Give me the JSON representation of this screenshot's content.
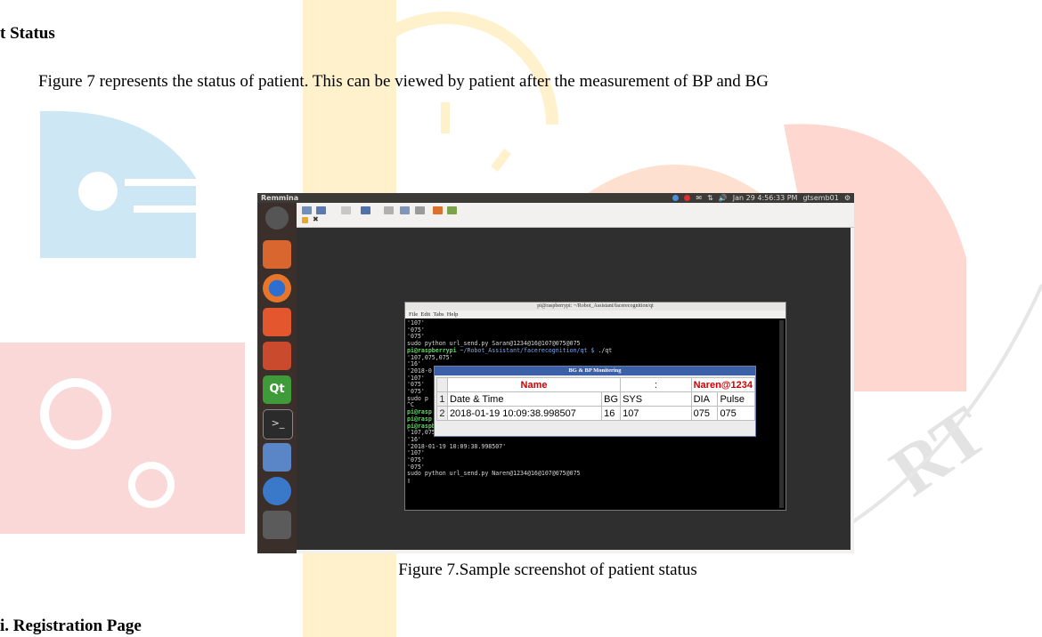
{
  "document": {
    "heading": "t Status",
    "paragraph": "Figure 7 represents the status of patient. This can be viewed by patient after the measurement of BP and BG",
    "caption": "Figure 7.Sample screenshot of patient status",
    "next_heading": "i. Registration Page"
  },
  "desktop": {
    "app_name": "Remmina",
    "clock": "Jan 29  4:56:33 PM",
    "user": "gtsemb01",
    "launcher_icons": [
      "dash-icon",
      "files-icon",
      "firefox-icon",
      "software-center-icon",
      "settings-icon",
      "qt-icon",
      "terminal-icon",
      "remote-desktop-icon",
      "app-icon",
      "workspace-icon",
      "trash-icon"
    ]
  },
  "terminal": {
    "title": "pi@raspberrypi: ~/Robot_Assistant/facerecognition/qt",
    "menu": [
      "File",
      "Edit",
      "Tabs",
      "Help"
    ],
    "lines_top": [
      "'107'",
      "'075'",
      "'075'",
      "sudo python url_send.py Saran@1234@16@107@075@075"
    ],
    "prompt_user": "pi@raspberrypi",
    "prompt_path": " ~/Robot_Assistant/facerecognition/qt $ ",
    "prompt_cmd": "./qt",
    "lines_mid": [
      "'107,075,075'",
      "'16'",
      "'2018-0",
      "'107'",
      "'075'",
      "'075'",
      "sudo p",
      "^C",
      "pi@rasp",
      "pi@rasp"
    ],
    "lines_bottom": [
      "'107,075,075'",
      "'16'",
      "'2018-01-19 10:09:38.998507'",
      "'107'",
      "'075'",
      "'075'",
      "sudo python url_send.py Naren@1234@16@107@075@075"
    ]
  },
  "monitor": {
    "title": "BG & BP Monitering",
    "name_label": "Name",
    "colon": ":",
    "name_value": "Naren@1234",
    "row_numbers": [
      "1",
      "2"
    ],
    "headers": [
      "Date & Time",
      "BG",
      "SYS",
      "DIA",
      "Pulse"
    ],
    "values": [
      "2018-01-19 10:09:38.998507",
      "16",
      "107",
      "075",
      "075"
    ]
  }
}
